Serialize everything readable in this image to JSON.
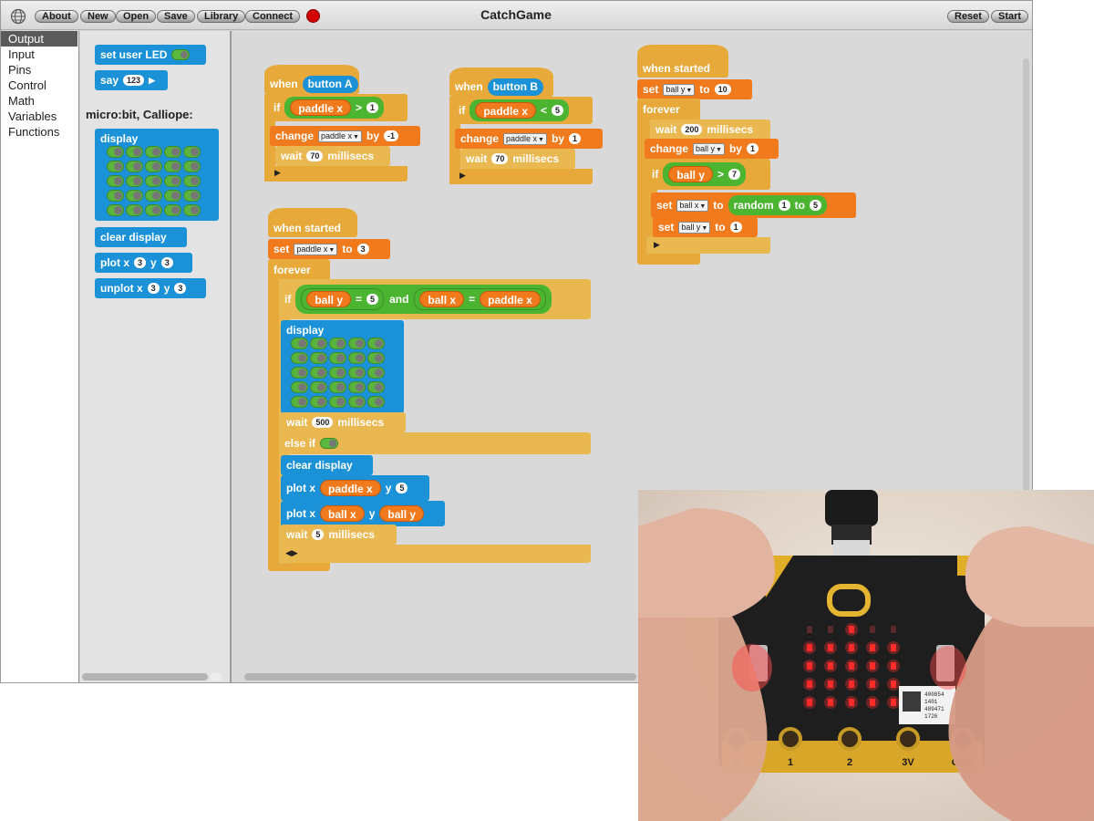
{
  "window": {
    "title": "CatchGame"
  },
  "toolbar": {
    "about": "About",
    "new": "New",
    "open": "Open",
    "save": "Save",
    "library": "Library",
    "connect": "Connect",
    "reset": "Reset",
    "start": "Start",
    "stop_color": "#d40000"
  },
  "categories": [
    "Output",
    "Input",
    "Pins",
    "Control",
    "Math",
    "Variables",
    "Functions"
  ],
  "selected_category": "Output",
  "palette": {
    "set_user_led": "set user LED",
    "say": "say",
    "say_value": "123",
    "section_label": "micro:bit, Calliope:",
    "display": "display",
    "clear_display": "clear display",
    "plot": "plot x",
    "unplot": "unplot x",
    "y": "y",
    "x_value": "3",
    "y_value": "3"
  },
  "colors": {
    "control": "#e6a93a",
    "output": "#1b92d8",
    "variables": "#f07a1c",
    "math": "#4bb531"
  },
  "kw": {
    "when": "when",
    "if": "if",
    "change": "change",
    "by": "by",
    "wait": "wait",
    "millisecs": "millisecs",
    "when_started": "when started",
    "set": "set",
    "to": "to",
    "forever": "forever",
    "and": "and",
    "display": "display",
    "else_if": "else if",
    "clear_display": "clear display",
    "plot_x": "plot x",
    "y": "y",
    "random": "random",
    "gt": ">",
    "lt": "<",
    "eq": "="
  },
  "vars": {
    "paddle_x": "paddle x",
    "ball_x": "ball x",
    "ball_y": "ball y"
  },
  "script_a": {
    "button": "button A",
    "cmp_value": "1",
    "change_by": "-1",
    "wait_ms": "70"
  },
  "script_b": {
    "button": "button B",
    "cmp_value": "5",
    "change_by": "1",
    "wait_ms": "70"
  },
  "script_main": {
    "set_value": "3",
    "ball_y_eq": "5",
    "wait_display_ms": "500",
    "plot_paddle_y": "5",
    "wait_end_ms": "5"
  },
  "script_ball": {
    "set_value": "10",
    "wait_ms": "200",
    "change_by": "1",
    "cmp_value": "7",
    "random_from": "1",
    "random_to": "5",
    "reset_value": "1"
  },
  "photo": {
    "pins": [
      "0",
      "1",
      "2",
      "3V",
      "GND"
    ],
    "sticker_lines": [
      "400854",
      "1401",
      "489471",
      "1726"
    ],
    "lit_leds": [
      [
        1,
        0
      ],
      [
        1,
        1
      ],
      [
        1,
        2
      ],
      [
        1,
        3
      ],
      [
        1,
        4
      ],
      [
        2,
        0
      ],
      [
        2,
        1
      ],
      [
        2,
        2
      ],
      [
        2,
        3
      ],
      [
        2,
        4
      ],
      [
        3,
        0
      ],
      [
        3,
        1
      ],
      [
        3,
        2
      ],
      [
        3,
        3
      ],
      [
        3,
        4
      ],
      [
        4,
        0
      ],
      [
        4,
        1
      ],
      [
        4,
        2
      ],
      [
        4,
        3
      ],
      [
        4,
        4
      ],
      [
        0,
        2
      ]
    ]
  }
}
